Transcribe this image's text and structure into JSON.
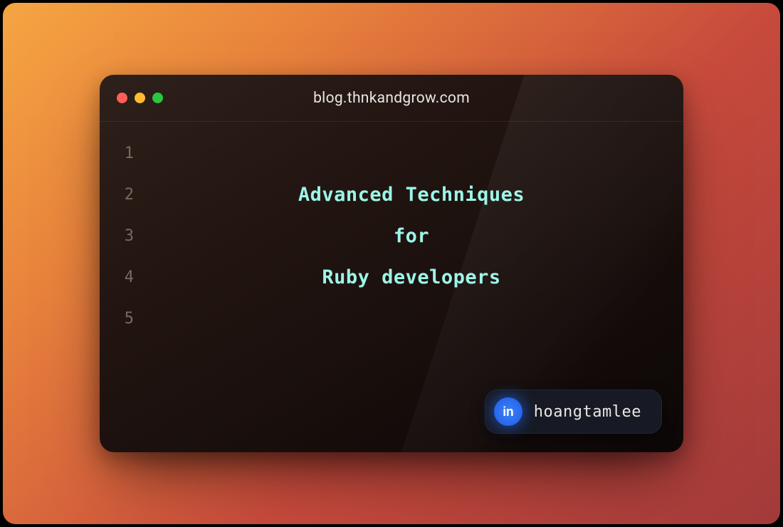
{
  "window": {
    "title": "blog.thnkandgrow.com"
  },
  "traffic_lights": {
    "close_color": "#ff5f57",
    "minimize_color": "#febc2e",
    "maximize_color": "#28c840"
  },
  "editor": {
    "line_numbers": [
      "1",
      "2",
      "3",
      "4",
      "5"
    ],
    "lines": [
      "",
      "Advanced Techniques",
      "for",
      "Ruby developers",
      ""
    ]
  },
  "social": {
    "platform": "linkedin",
    "icon_text": "in",
    "handle": "hoangtamlee"
  }
}
